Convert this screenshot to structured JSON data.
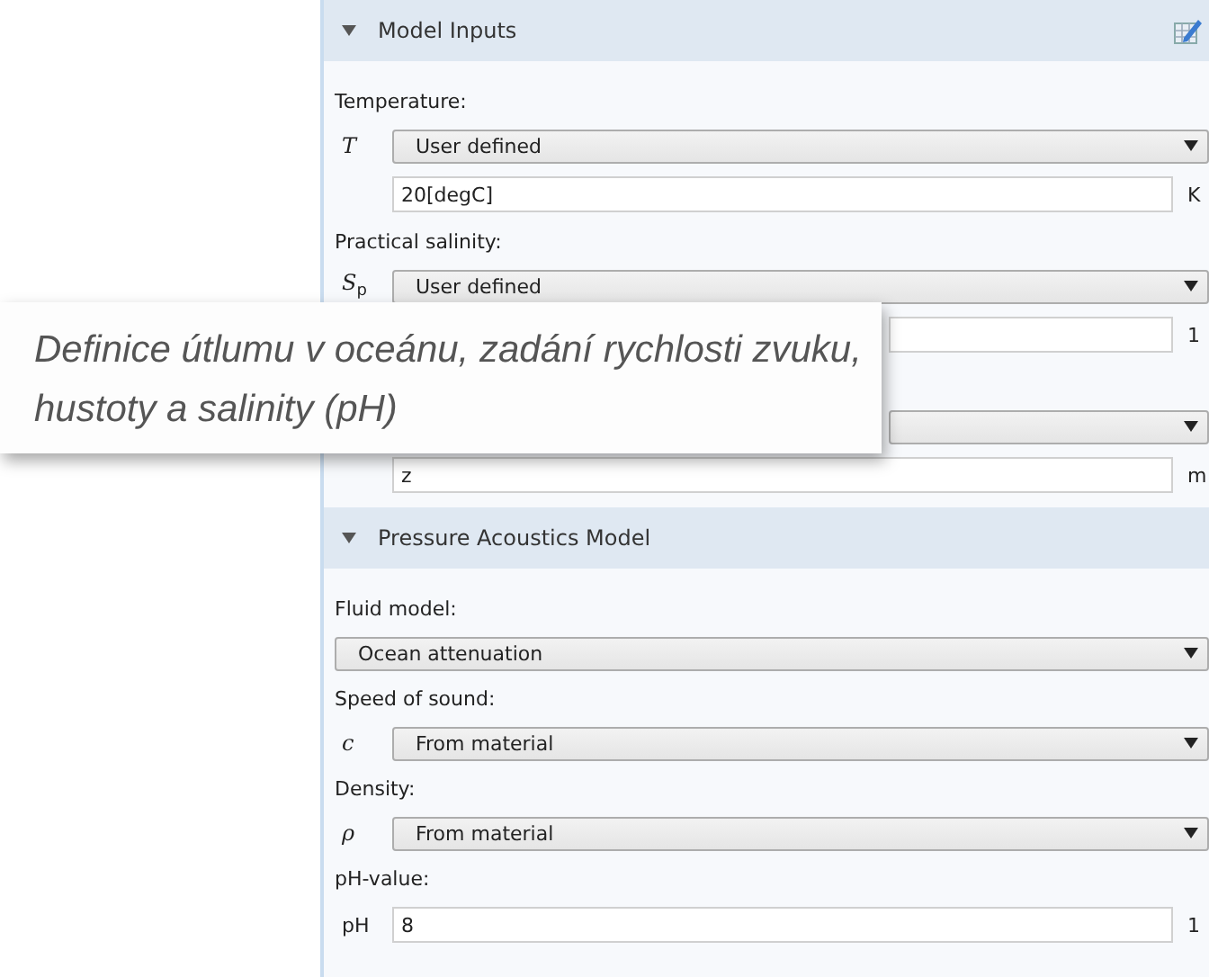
{
  "sections": [
    {
      "title": "Model Inputs",
      "editable": true,
      "rows": [
        {
          "kind": "label",
          "text": "Temperature:"
        },
        {
          "kind": "select",
          "symbol": "*T*",
          "value": "User defined"
        },
        {
          "kind": "input",
          "value": "20[degC]",
          "unit": "K"
        },
        {
          "kind": "label",
          "text": "Practical salinity:"
        },
        {
          "kind": "select",
          "symbol": "*S*$_{p}$",
          "value": "User defined"
        },
        {
          "kind": "input",
          "value": "",
          "unit": "1"
        },
        {
          "kind": "spacer"
        },
        {
          "kind": "select",
          "value": ""
        },
        {
          "kind": "input",
          "value": "z",
          "unit": "m"
        }
      ]
    },
    {
      "title": "Pressure Acoustics Model",
      "rows": [
        {
          "kind": "label",
          "text": "Fluid model:"
        },
        {
          "kind": "select_wide",
          "value": "Ocean attenuation"
        },
        {
          "kind": "label",
          "text": "Speed of sound:"
        },
        {
          "kind": "select",
          "symbol": "*c*",
          "value": "From material"
        },
        {
          "kind": "label",
          "text": "Density:"
        },
        {
          "kind": "select",
          "symbol": "*ρ*",
          "value": "From material"
        },
        {
          "kind": "label",
          "text": "pH-value:"
        },
        {
          "kind": "input",
          "symbol": "pH",
          "value": "8",
          "unit": "1"
        }
      ]
    }
  ],
  "callout": {
    "text": "Definice útlumu v oceánu, zadání rychlosti zvuku, hustoty a salinity (pH)"
  }
}
